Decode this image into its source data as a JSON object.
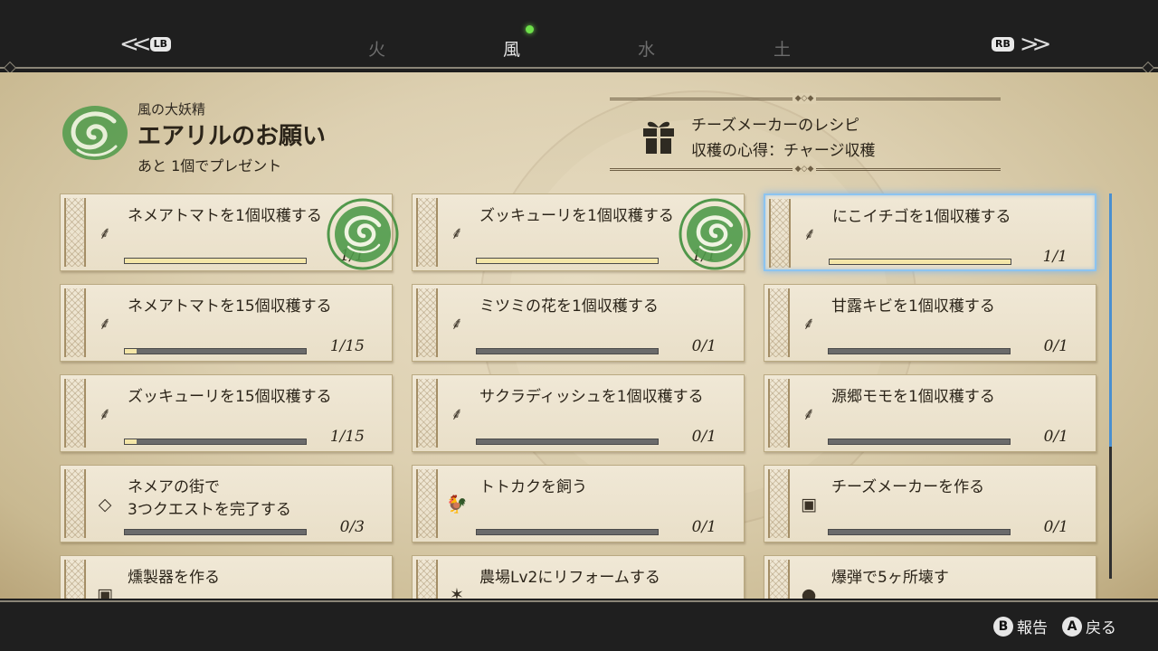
{
  "topbar": {
    "lb": "LB",
    "rb": "RB",
    "elements": [
      {
        "label": "火",
        "active": false
      },
      {
        "label": "風",
        "active": true
      },
      {
        "label": "水",
        "active": false
      },
      {
        "label": "土",
        "active": false
      }
    ]
  },
  "fairy": {
    "kicker": "風の大妖精",
    "title": "エアリルのお願い",
    "remaining": "あと 1個でプレゼント"
  },
  "reward": {
    "line1": "チーズメーカーのレシピ",
    "line2": "収穫の心得：チャージ収穫"
  },
  "quests": [
    {
      "title": "ネメアトマトを1個収穫する",
      "count": "1/1",
      "progress": 1.0,
      "icon": "harvest-icon",
      "completed": true
    },
    {
      "title": "ズッキューリを1個収穫する",
      "count": "1/1",
      "progress": 1.0,
      "icon": "harvest-icon",
      "completed": true
    },
    {
      "title": "にこイチゴを1個収穫する",
      "count": "1/1",
      "progress": 1.0,
      "icon": "harvest-icon",
      "completed": false,
      "selected": true
    },
    {
      "title": "ネメアトマトを15個収穫する",
      "count": "1/15",
      "progress": 0.067,
      "icon": "harvest-icon"
    },
    {
      "title": "ミツミの花を1個収穫する",
      "count": "0/1",
      "progress": 0,
      "icon": "harvest-icon"
    },
    {
      "title": "甘露キビを1個収穫する",
      "count": "0/1",
      "progress": 0,
      "icon": "harvest-icon"
    },
    {
      "title": "ズッキューリを15個収穫する",
      "count": "1/15",
      "progress": 0.067,
      "icon": "harvest-icon"
    },
    {
      "title": "サクラディッシュを1個収穫する",
      "count": "0/1",
      "progress": 0,
      "icon": "harvest-icon"
    },
    {
      "title": "源郷モモを1個収穫する",
      "count": "0/1",
      "progress": 0,
      "icon": "harvest-icon"
    },
    {
      "title": "ネメアの街で",
      "title2": "3つクエストを完了する",
      "count": "0/3",
      "progress": 0,
      "icon": "quest-alert-icon"
    },
    {
      "title": "トトカクを飼う",
      "count": "0/1",
      "progress": 0,
      "icon": "bird-icon"
    },
    {
      "title": "チーズメーカーを作る",
      "count": "0/1",
      "progress": 0,
      "icon": "machine-icon"
    },
    {
      "title": "燻製器を作る",
      "count": "",
      "progress": 0,
      "icon": "machine-icon"
    },
    {
      "title": "農場Lv2にリフォームする",
      "count": "",
      "progress": 0,
      "icon": "farm-icon"
    },
    {
      "title": "爆弾で5ヶ所壊す",
      "count": "",
      "progress": 0,
      "icon": "bomb-icon"
    }
  ],
  "footer": {
    "b_key": "B",
    "b_label": "報告",
    "a_key": "A",
    "a_label": "戻る"
  },
  "colors": {
    "wind_green": "#3f8f3c",
    "selection_blue": "#8cc4f0",
    "bar_fill": "#f4e6a8"
  }
}
